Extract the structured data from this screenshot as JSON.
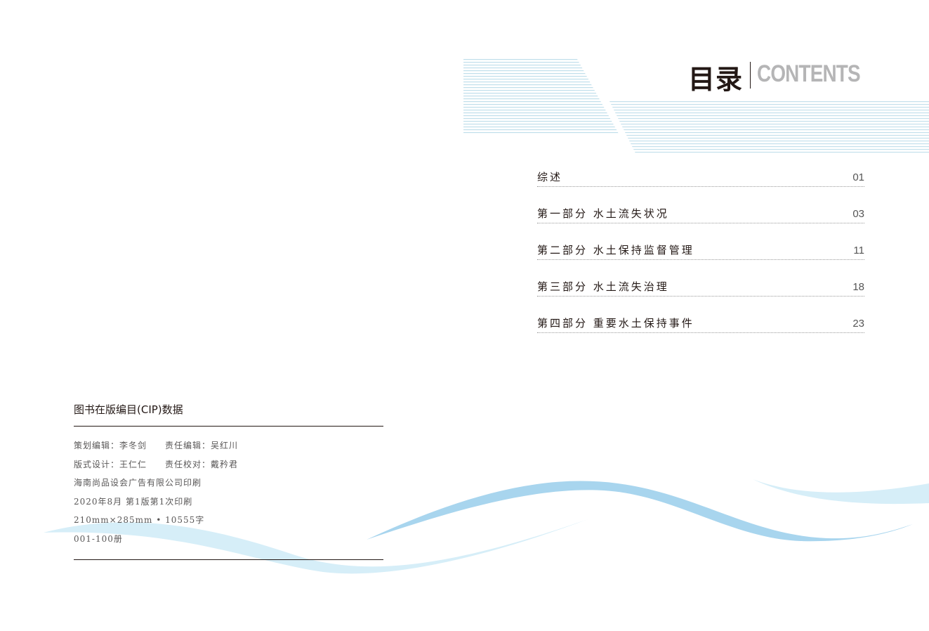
{
  "header": {
    "title_cn": "目录",
    "title_en": "CONTENTS"
  },
  "toc": {
    "items": [
      {
        "label": "综述",
        "page": "01"
      },
      {
        "label": "第一部分 水土流失状况",
        "page": "03"
      },
      {
        "label": "第二部分 水土保持监督管理",
        "page": "11"
      },
      {
        "label": "第三部分 水土流失治理",
        "page": "18"
      },
      {
        "label": "第四部分 重要水土保持事件",
        "page": "23"
      }
    ]
  },
  "cip": {
    "title": "图书在版编目(CIP)数据",
    "lines": [
      "策划编辑：李冬剑　　责任编辑：吴红川",
      "版式设计：王仁仁　　责任校对：戴矜君",
      "海南尚品设会广告有限公司印刷",
      "2020年8月 第1版第1次印刷",
      "210mm×285mm • 10555字",
      "001-100册"
    ]
  },
  "colors": {
    "wave_dark": "#a8d5ee",
    "wave_light": "#d6eef8",
    "title_grey": "#b5b5b6",
    "ink": "#231815"
  }
}
